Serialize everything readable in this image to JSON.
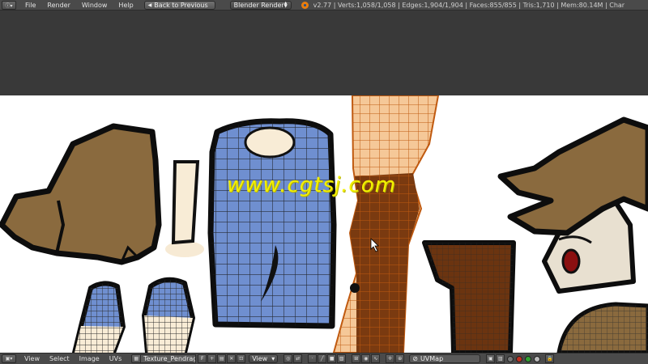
{
  "top_header": {
    "editor_icon": "info-editor-icon",
    "menu": [
      "File",
      "Render",
      "Window",
      "Help"
    ],
    "back_button": "Back to Previous",
    "render_engine": "Blender Render",
    "stats": "v2.77 | Verts:1,058/1,058 | Edges:1,904/1,904 | Faces:855/855 | Tris:1,710 | Mem:80.14M | Char"
  },
  "uv_editor": {
    "watermark": "www.cgtsj.com"
  },
  "bottom_header": {
    "editor_icon": "image-editor-icon",
    "menu": [
      "View",
      "Select",
      "Image",
      "UVs"
    ],
    "texture_name": "Texture_Pendrago...",
    "fake_user": "F",
    "view_mode": "View",
    "uv_map": "UVMap"
  },
  "colors": {
    "header_bg": "#4a4a4a",
    "viewport_bg": "#393939",
    "uv_bg": "#ffffff",
    "blue_fill": "#6f8fd0",
    "brown_fill": "#8a6a3e",
    "dark_brown": "#6b3410",
    "skin": "#f5e7cf",
    "watermark": "#f3f000"
  }
}
